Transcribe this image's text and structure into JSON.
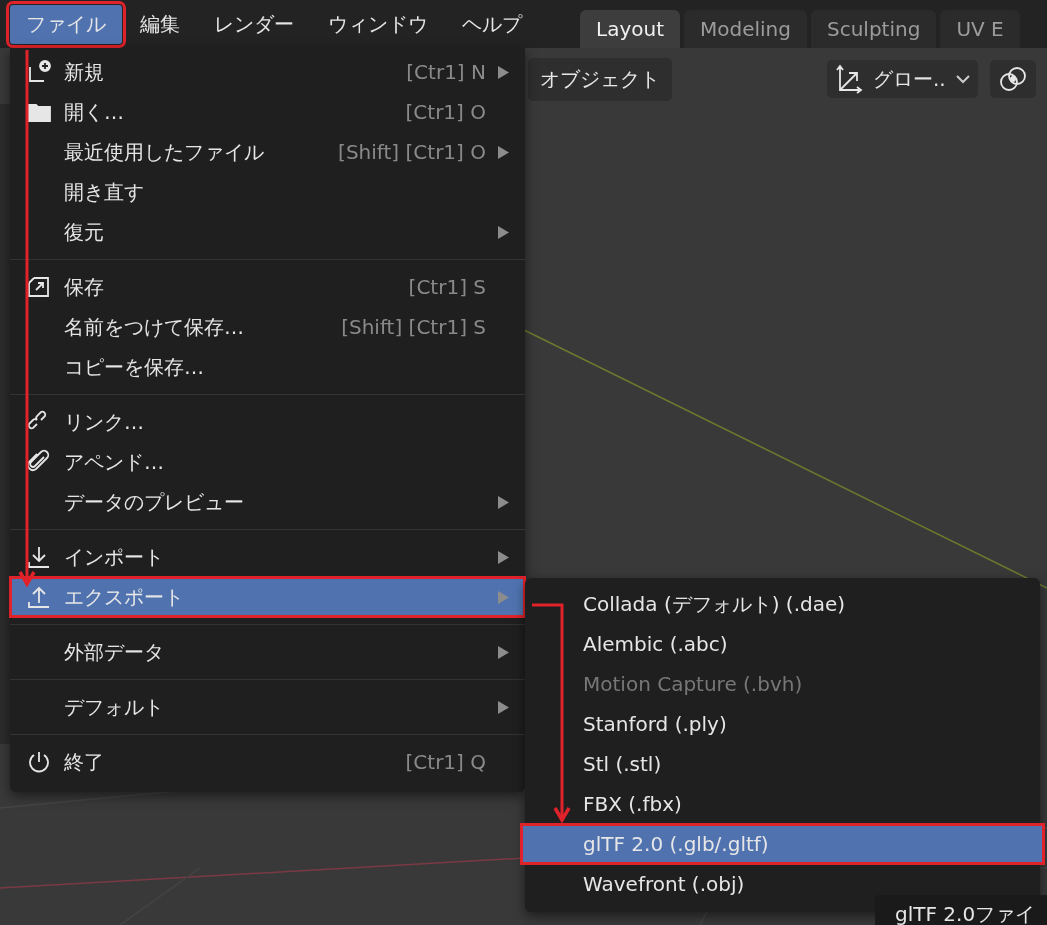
{
  "menu_bar": [
    {
      "label": "ファイル",
      "selected": true,
      "annotated": true
    },
    {
      "label": "編集",
      "selected": false,
      "annotated": false
    },
    {
      "label": "レンダー",
      "selected": false,
      "annotated": false
    },
    {
      "label": "ウィンドウ",
      "selected": false,
      "annotated": false
    },
    {
      "label": "ヘルプ",
      "selected": false,
      "annotated": false
    }
  ],
  "workspace_tabs": [
    {
      "label": "Layout",
      "selected": true
    },
    {
      "label": "Modeling",
      "selected": false
    },
    {
      "label": "Sculpting",
      "selected": false
    },
    {
      "label": "UV E",
      "selected": false
    }
  ],
  "viewport_header": {
    "mode_button": "オブジェクト",
    "orientation_dropdown": "グロー.."
  },
  "file_menu": {
    "groups": [
      [
        {
          "label": "新規",
          "shortcut": "[Ctr1] N",
          "kind": "new",
          "submenu": true,
          "selected": false,
          "annotated": false
        },
        {
          "label": "開く…",
          "shortcut": "[Ctr1] O",
          "kind": "open",
          "submenu": false,
          "selected": false,
          "annotated": false
        },
        {
          "label": "最近使用したファイル",
          "shortcut": "[Shift] [Ctr1] O",
          "submenu": true,
          "selected": false,
          "annotated": false
        },
        {
          "label": "開き直す",
          "submenu": false,
          "selected": false,
          "annotated": false
        },
        {
          "label": "復元",
          "submenu": true,
          "selected": false,
          "annotated": false
        }
      ],
      [
        {
          "label": "保存",
          "shortcut": "[Ctr1] S",
          "kind": "save",
          "submenu": false,
          "selected": false,
          "annotated": false
        },
        {
          "label": "名前をつけて保存…",
          "shortcut": "[Shift] [Ctr1] S",
          "submenu": false,
          "selected": false,
          "annotated": false
        },
        {
          "label": "コピーを保存…",
          "submenu": false,
          "selected": false,
          "annotated": false
        }
      ],
      [
        {
          "label": "リンク…",
          "kind": "link",
          "submenu": false,
          "selected": false,
          "annotated": false
        },
        {
          "label": "アペンド…",
          "kind": "append",
          "submenu": false,
          "selected": false,
          "annotated": false
        },
        {
          "label": "データのプレビュー",
          "submenu": true,
          "selected": false,
          "annotated": false
        }
      ],
      [
        {
          "label": "インポート",
          "kind": "import",
          "submenu": true,
          "selected": false,
          "annotated": false
        },
        {
          "label": "エクスポート",
          "kind": "export",
          "submenu": true,
          "selected": true,
          "annotated": true
        }
      ],
      [
        {
          "label": "外部データ",
          "submenu": true,
          "selected": false,
          "annotated": false
        }
      ],
      [
        {
          "label": "デフォルト",
          "submenu": true,
          "selected": false,
          "annotated": false
        }
      ],
      [
        {
          "label": "終了",
          "shortcut": "[Ctr1] Q",
          "kind": "quit",
          "submenu": false,
          "selected": false,
          "annotated": false
        }
      ]
    ]
  },
  "export_menu": {
    "items": [
      {
        "label": "Collada (デフォルト) (.dae)",
        "disabled": false,
        "selected": false,
        "annotated": false
      },
      {
        "label": "Alembic (.abc)",
        "disabled": false,
        "selected": false,
        "annotated": false
      },
      {
        "label": "Motion Capture (.bvh)",
        "disabled": true,
        "selected": false,
        "annotated": false
      },
      {
        "label": "Stanford (.ply)",
        "disabled": false,
        "selected": false,
        "annotated": false
      },
      {
        "label": "Stl (.stl)",
        "disabled": false,
        "selected": false,
        "annotated": false
      },
      {
        "label": "FBX (.fbx)",
        "disabled": false,
        "selected": false,
        "annotated": false
      },
      {
        "label": "glTF 2.0 (.glb/.gltf)",
        "disabled": false,
        "selected": true,
        "annotated": true
      },
      {
        "label": "Wavefront (.obj)",
        "disabled": false,
        "selected": false,
        "annotated": false
      }
    ]
  },
  "tooltip": "glTF 2.0ファイ"
}
